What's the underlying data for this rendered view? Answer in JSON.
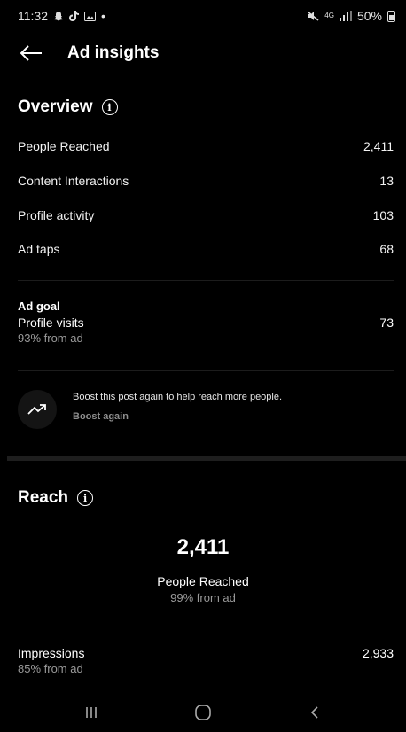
{
  "status_bar": {
    "time": "11:32",
    "notif_glyphs": "•",
    "signal_text": "4G",
    "battery": "50%"
  },
  "header": {
    "title": "Ad insights"
  },
  "overview": {
    "title": "Overview",
    "metrics": [
      {
        "label": "People Reached",
        "value": "2,411"
      },
      {
        "label": "Content Interactions",
        "value": "13"
      },
      {
        "label": "Profile activity",
        "value": "103"
      },
      {
        "label": "Ad taps",
        "value": "68"
      }
    ],
    "ad_goal": {
      "label": "Ad goal",
      "metric": "Profile visits",
      "value": "73",
      "sub": "93% from ad"
    },
    "boost": {
      "text": "Boost this post again to help reach more people.",
      "link": "Boost again"
    }
  },
  "reach": {
    "title": "Reach",
    "big_value": "2,411",
    "label": "People Reached",
    "sub": "99% from ad",
    "impressions": {
      "label": "Impressions",
      "value": "2,933",
      "sub": "85% from ad"
    }
  }
}
